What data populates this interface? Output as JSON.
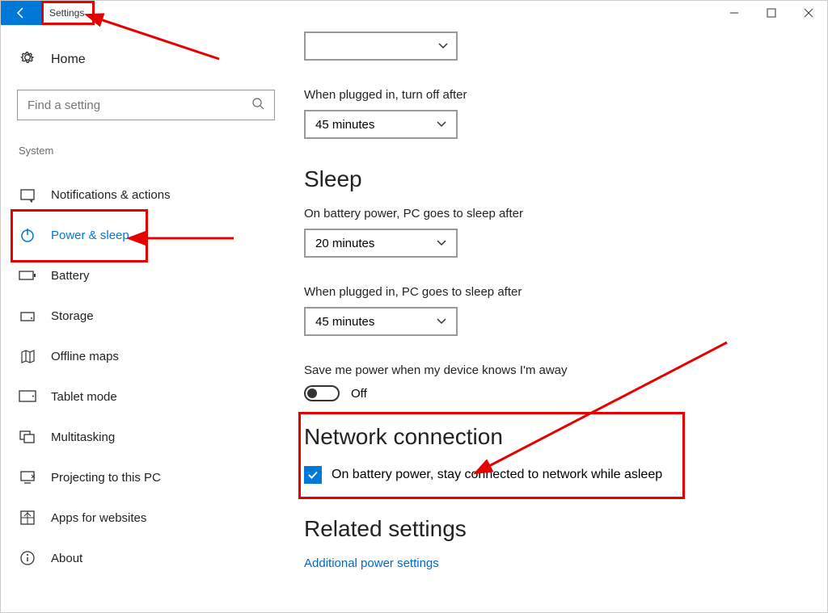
{
  "titlebar": {
    "title": "Settings"
  },
  "sidebar": {
    "home": "Home",
    "search_placeholder": "Find a setting",
    "section": "System",
    "items": [
      {
        "label": "Notifications & actions"
      },
      {
        "label": "Power & sleep"
      },
      {
        "label": "Battery"
      },
      {
        "label": "Storage"
      },
      {
        "label": "Offline maps"
      },
      {
        "label": "Tablet mode"
      },
      {
        "label": "Multitasking"
      },
      {
        "label": "Projecting to this PC"
      },
      {
        "label": "Apps for websites"
      },
      {
        "label": "About"
      }
    ]
  },
  "main": {
    "plugged_off_label": "When plugged in, turn off after",
    "plugged_off_value": "45 minutes",
    "sleep_heading": "Sleep",
    "battery_sleep_label": "On battery power, PC goes to sleep after",
    "battery_sleep_value": "20 minutes",
    "plugged_sleep_label": "When plugged in, PC goes to sleep after",
    "plugged_sleep_value": "45 minutes",
    "away_label": "Save me power when my device knows I'm away",
    "away_toggle": "Off",
    "network_heading": "Network connection",
    "network_checkbox": "On battery power, stay connected to network while asleep",
    "related_heading": "Related settings",
    "related_link": "Additional power settings"
  }
}
